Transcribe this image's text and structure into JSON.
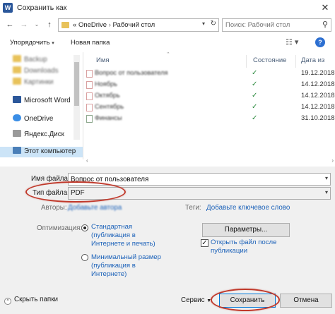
{
  "window": {
    "title": "Сохранить как",
    "app_icon": "W",
    "close_glyph": "✕"
  },
  "address": {
    "breadcrumb_prefix": "«",
    "crumbs": [
      "OneDrive",
      "Рабочий стол"
    ],
    "search_placeholder": "Поиск: Рабочий стол"
  },
  "toolbar": {
    "organize": "Упорядочить",
    "new_folder": "Новая папка"
  },
  "nav": {
    "blurred_items": [
      "Backup",
      "Downloads",
      "Картинки"
    ],
    "items": [
      {
        "label": "Microsoft Word",
        "icon": "word-icon"
      },
      {
        "label": "OneDrive",
        "icon": "cloud-icon"
      },
      {
        "label": "Яндекс.Диск",
        "icon": "disk-icon"
      },
      {
        "label": "Этот компьютер",
        "icon": "computer-icon",
        "selected": true
      }
    ]
  },
  "files": {
    "columns": {
      "name": "Имя",
      "status": "Состояние",
      "date": "Дата из"
    },
    "rows": [
      {
        "name": "Вопрос от пользователя",
        "status": "✓",
        "date": "19.12.2018"
      },
      {
        "name": "Ноябрь",
        "status": "✓",
        "date": "14.12.2018"
      },
      {
        "name": "Октябрь",
        "status": "✓",
        "date": "14.12.2018"
      },
      {
        "name": "Сентябрь",
        "status": "✓",
        "date": "14.12.2018"
      },
      {
        "name": "Финансы",
        "status": "✓",
        "date": "31.10.2018"
      }
    ]
  },
  "form": {
    "filename_label": "Имя файла:",
    "filename_value": "Вопрос от пользователя",
    "filetype_label": "Тип файла:",
    "filetype_value": "PDF",
    "authors_label": "Авторы:",
    "authors_value": "Добавьте автора",
    "tags_label": "Теги:",
    "tags_value": "Добавьте ключевое слово",
    "optimize_label": "Оптимизация:",
    "opt_standard": "Стандартная (публикация в Интернете и печать)",
    "opt_minimal": "Минимальный размер (публикация в Интернете)",
    "params_button": "Параметры...",
    "open_after_label": "Открыть файл после публикации",
    "open_after_checked": true
  },
  "footer": {
    "hide_folders": "Скрыть папки",
    "tools": "Сервис",
    "save": "Сохранить",
    "cancel": "Отмена"
  },
  "colors": {
    "accent": "#0078d7",
    "link": "#1c62b9",
    "highlight": "#c0392b",
    "selection": "#cce4f7"
  }
}
